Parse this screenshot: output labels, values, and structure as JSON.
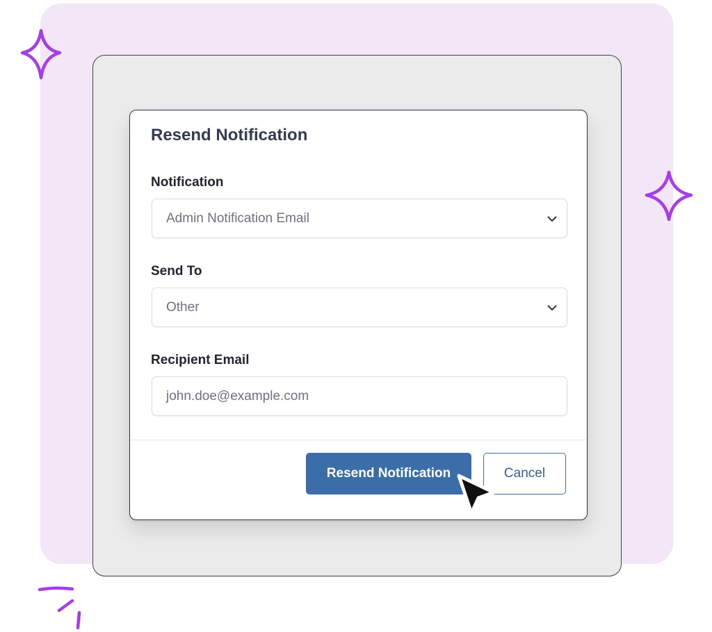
{
  "dialog": {
    "title": "Resend Notification",
    "notification_label": "Notification",
    "notification_value": "Admin Notification Email",
    "send_to_label": "Send To",
    "send_to_value": "Other",
    "recipient_label": "Recipient Email",
    "recipient_placeholder": "john.doe@example.com",
    "resend_button": "Resend Notification",
    "cancel_button": "Cancel"
  },
  "colors": {
    "background_panel": "#f3e6f6",
    "frame": "#ebebec",
    "primary_button": "#3b6ea8",
    "sparkle": "#a63ee8"
  },
  "icons": [
    "sparkle-icon",
    "chevron-down-icon",
    "mouse-pointer-icon",
    "scribble-mark-icon"
  ]
}
